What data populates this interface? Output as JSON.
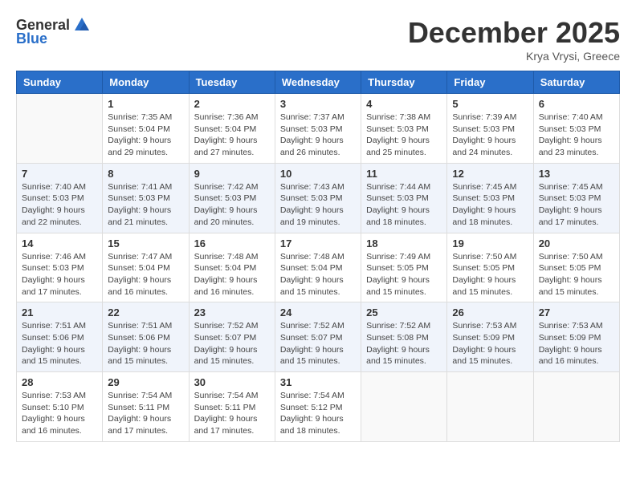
{
  "logo": {
    "general": "General",
    "blue": "Blue"
  },
  "title": "December 2025",
  "location": "Krya Vrysi, Greece",
  "days_header": [
    "Sunday",
    "Monday",
    "Tuesday",
    "Wednesday",
    "Thursday",
    "Friday",
    "Saturday"
  ],
  "weeks": [
    [
      {
        "day": "",
        "info": ""
      },
      {
        "day": "1",
        "info": "Sunrise: 7:35 AM\nSunset: 5:04 PM\nDaylight: 9 hours\nand 29 minutes."
      },
      {
        "day": "2",
        "info": "Sunrise: 7:36 AM\nSunset: 5:04 PM\nDaylight: 9 hours\nand 27 minutes."
      },
      {
        "day": "3",
        "info": "Sunrise: 7:37 AM\nSunset: 5:03 PM\nDaylight: 9 hours\nand 26 minutes."
      },
      {
        "day": "4",
        "info": "Sunrise: 7:38 AM\nSunset: 5:03 PM\nDaylight: 9 hours\nand 25 minutes."
      },
      {
        "day": "5",
        "info": "Sunrise: 7:39 AM\nSunset: 5:03 PM\nDaylight: 9 hours\nand 24 minutes."
      },
      {
        "day": "6",
        "info": "Sunrise: 7:40 AM\nSunset: 5:03 PM\nDaylight: 9 hours\nand 23 minutes."
      }
    ],
    [
      {
        "day": "7",
        "info": "Sunrise: 7:40 AM\nSunset: 5:03 PM\nDaylight: 9 hours\nand 22 minutes."
      },
      {
        "day": "8",
        "info": "Sunrise: 7:41 AM\nSunset: 5:03 PM\nDaylight: 9 hours\nand 21 minutes."
      },
      {
        "day": "9",
        "info": "Sunrise: 7:42 AM\nSunset: 5:03 PM\nDaylight: 9 hours\nand 20 minutes."
      },
      {
        "day": "10",
        "info": "Sunrise: 7:43 AM\nSunset: 5:03 PM\nDaylight: 9 hours\nand 19 minutes."
      },
      {
        "day": "11",
        "info": "Sunrise: 7:44 AM\nSunset: 5:03 PM\nDaylight: 9 hours\nand 18 minutes."
      },
      {
        "day": "12",
        "info": "Sunrise: 7:45 AM\nSunset: 5:03 PM\nDaylight: 9 hours\nand 18 minutes."
      },
      {
        "day": "13",
        "info": "Sunrise: 7:45 AM\nSunset: 5:03 PM\nDaylight: 9 hours\nand 17 minutes."
      }
    ],
    [
      {
        "day": "14",
        "info": "Sunrise: 7:46 AM\nSunset: 5:03 PM\nDaylight: 9 hours\nand 17 minutes."
      },
      {
        "day": "15",
        "info": "Sunrise: 7:47 AM\nSunset: 5:04 PM\nDaylight: 9 hours\nand 16 minutes."
      },
      {
        "day": "16",
        "info": "Sunrise: 7:48 AM\nSunset: 5:04 PM\nDaylight: 9 hours\nand 16 minutes."
      },
      {
        "day": "17",
        "info": "Sunrise: 7:48 AM\nSunset: 5:04 PM\nDaylight: 9 hours\nand 15 minutes."
      },
      {
        "day": "18",
        "info": "Sunrise: 7:49 AM\nSunset: 5:05 PM\nDaylight: 9 hours\nand 15 minutes."
      },
      {
        "day": "19",
        "info": "Sunrise: 7:50 AM\nSunset: 5:05 PM\nDaylight: 9 hours\nand 15 minutes."
      },
      {
        "day": "20",
        "info": "Sunrise: 7:50 AM\nSunset: 5:05 PM\nDaylight: 9 hours\nand 15 minutes."
      }
    ],
    [
      {
        "day": "21",
        "info": "Sunrise: 7:51 AM\nSunset: 5:06 PM\nDaylight: 9 hours\nand 15 minutes."
      },
      {
        "day": "22",
        "info": "Sunrise: 7:51 AM\nSunset: 5:06 PM\nDaylight: 9 hours\nand 15 minutes."
      },
      {
        "day": "23",
        "info": "Sunrise: 7:52 AM\nSunset: 5:07 PM\nDaylight: 9 hours\nand 15 minutes."
      },
      {
        "day": "24",
        "info": "Sunrise: 7:52 AM\nSunset: 5:07 PM\nDaylight: 9 hours\nand 15 minutes."
      },
      {
        "day": "25",
        "info": "Sunrise: 7:52 AM\nSunset: 5:08 PM\nDaylight: 9 hours\nand 15 minutes."
      },
      {
        "day": "26",
        "info": "Sunrise: 7:53 AM\nSunset: 5:09 PM\nDaylight: 9 hours\nand 15 minutes."
      },
      {
        "day": "27",
        "info": "Sunrise: 7:53 AM\nSunset: 5:09 PM\nDaylight: 9 hours\nand 16 minutes."
      }
    ],
    [
      {
        "day": "28",
        "info": "Sunrise: 7:53 AM\nSunset: 5:10 PM\nDaylight: 9 hours\nand 16 minutes."
      },
      {
        "day": "29",
        "info": "Sunrise: 7:54 AM\nSunset: 5:11 PM\nDaylight: 9 hours\nand 17 minutes."
      },
      {
        "day": "30",
        "info": "Sunrise: 7:54 AM\nSunset: 5:11 PM\nDaylight: 9 hours\nand 17 minutes."
      },
      {
        "day": "31",
        "info": "Sunrise: 7:54 AM\nSunset: 5:12 PM\nDaylight: 9 hours\nand 18 minutes."
      },
      {
        "day": "",
        "info": ""
      },
      {
        "day": "",
        "info": ""
      },
      {
        "day": "",
        "info": ""
      }
    ]
  ]
}
